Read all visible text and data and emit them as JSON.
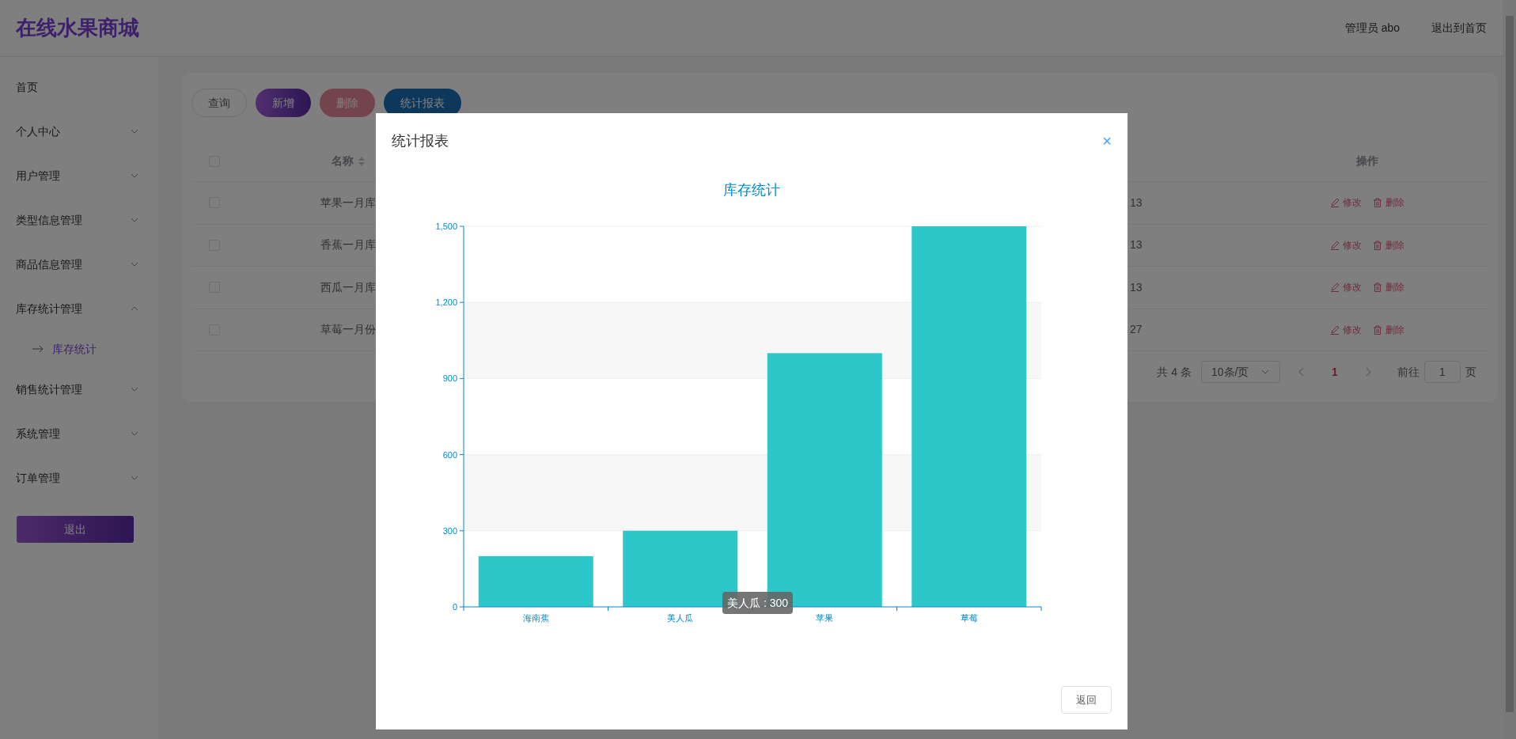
{
  "header": {
    "title": "在线水果商城",
    "user": "管理员 abo",
    "exit_link": "退出到首页"
  },
  "sidebar": {
    "items": [
      {
        "label": "首页",
        "kind": "link"
      },
      {
        "label": "个人中心",
        "kind": "menu",
        "expanded": false
      },
      {
        "label": "用户管理",
        "kind": "menu",
        "expanded": false
      },
      {
        "label": "类型信息管理",
        "kind": "menu",
        "expanded": false
      },
      {
        "label": "商品信息管理",
        "kind": "menu",
        "expanded": false
      },
      {
        "label": "库存统计管理",
        "kind": "menu",
        "expanded": true,
        "children": [
          {
            "label": "库存统计",
            "selected": true
          }
        ]
      },
      {
        "label": "销售统计管理",
        "kind": "menu",
        "expanded": false
      },
      {
        "label": "系统管理",
        "kind": "menu",
        "expanded": false
      },
      {
        "label": "订单管理",
        "kind": "menu",
        "expanded": false
      }
    ],
    "logout": "退出"
  },
  "toolbar": [
    {
      "label": "查询",
      "kind": "plain"
    },
    {
      "label": "新增",
      "kind": "add"
    },
    {
      "label": "删除",
      "kind": "delete"
    },
    {
      "label": "统计报表",
      "kind": "report"
    }
  ],
  "table": {
    "all_checked": false,
    "columns": [
      "名称",
      "操作"
    ],
    "rows": [
      {
        "checked": false,
        "name": "苹果一月库",
        "column_3": "13",
        "actions": [
          "修改",
          "删除"
        ]
      },
      {
        "checked": false,
        "name": "香蕉一月库",
        "column_3": "13",
        "actions": [
          "修改",
          "删除"
        ]
      },
      {
        "checked": false,
        "name": "西瓜一月库",
        "column_3": "13",
        "actions": [
          "修改",
          "删除"
        ]
      },
      {
        "checked": false,
        "name": "草莓一月份",
        "column_3": "27",
        "actions": [
          "修改",
          "删除"
        ]
      }
    ]
  },
  "pagination": {
    "total": "共 4 条",
    "page_size": "10条/页",
    "current": "1",
    "goto_label": "前往",
    "goto_value": "1",
    "page_unit": "页"
  },
  "modal": {
    "title": "统计报表",
    "close": "×",
    "chart_data": {
      "type": "bar",
      "title": "库存统计",
      "categories": [
        "海南蕉",
        "美人瓜",
        "苹果",
        "草莓"
      ],
      "series": [
        {
          "color": "#2ec7c9",
          "values": [
            200,
            300,
            1000,
            1500
          ]
        }
      ],
      "grid": true,
      "ylim": [
        0,
        1500
      ],
      "yticks": [
        0,
        {
          "value": 300,
          "label": "300"
        },
        {
          "value": 600,
          "label": "600"
        },
        {
          "value": 900,
          "label": "900"
        },
        {
          "value": 1200,
          "label": "1,200"
        },
        {
          "value": 1500,
          "label": "1,500"
        }
      ]
    },
    "tooltip": "美人瓜 : 300",
    "back_button": "返回"
  }
}
